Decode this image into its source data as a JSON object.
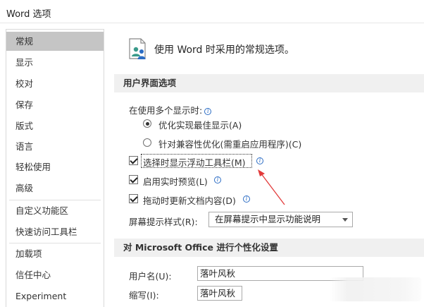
{
  "window": {
    "title": "Word 选项"
  },
  "sidebar": {
    "items": [
      {
        "label": "常规",
        "selected": true
      },
      {
        "label": "显示"
      },
      {
        "label": "校对"
      },
      {
        "label": "保存"
      },
      {
        "label": "版式"
      },
      {
        "label": "语言"
      },
      {
        "label": "轻松使用"
      },
      {
        "label": "高级"
      },
      {
        "label": "自定义功能区"
      },
      {
        "label": "快速访问工具栏"
      },
      {
        "label": "加载项"
      },
      {
        "label": "信任中心"
      },
      {
        "label": "Experiment"
      }
    ]
  },
  "main": {
    "header": "使用 Word 时采用的常规选项。",
    "ui_section": {
      "title": "用户界面选项",
      "multi_display_label": "在使用多个显示时:",
      "radio_optimize": {
        "label": "优化实现最佳显示(A)",
        "checked": true
      },
      "radio_compat": {
        "label": "针对兼容性优化(需重启应用程序)(C)",
        "checked": false
      },
      "check_mini_toolbar": {
        "label": "选择时显示浮动工具栏(M)",
        "checked": true
      },
      "check_live_preview": {
        "label": "启用实时预览(L)",
        "checked": true
      },
      "check_update_drag": {
        "label": "拖动时更新文档内容(D)",
        "checked": true
      },
      "screentip_label": "屏幕提示样式(R):",
      "screentip_value": "在屏幕提示中显示功能说明"
    },
    "personalize_section": {
      "title": "对 Microsoft Office 进行个性化设置",
      "username_label": "用户名(U):",
      "username_value": "落叶风秋",
      "initials_label": "缩写(I):",
      "initials_value": "落叶风秋"
    }
  },
  "colors": {
    "accent_info": "#2b6cc4",
    "annotation_arrow": "#e23b3b",
    "selected_nav": "#c5c5c5",
    "section_bar": "#f0f0f0"
  },
  "icons": [
    "general-options-icon",
    "info-icon"
  ]
}
